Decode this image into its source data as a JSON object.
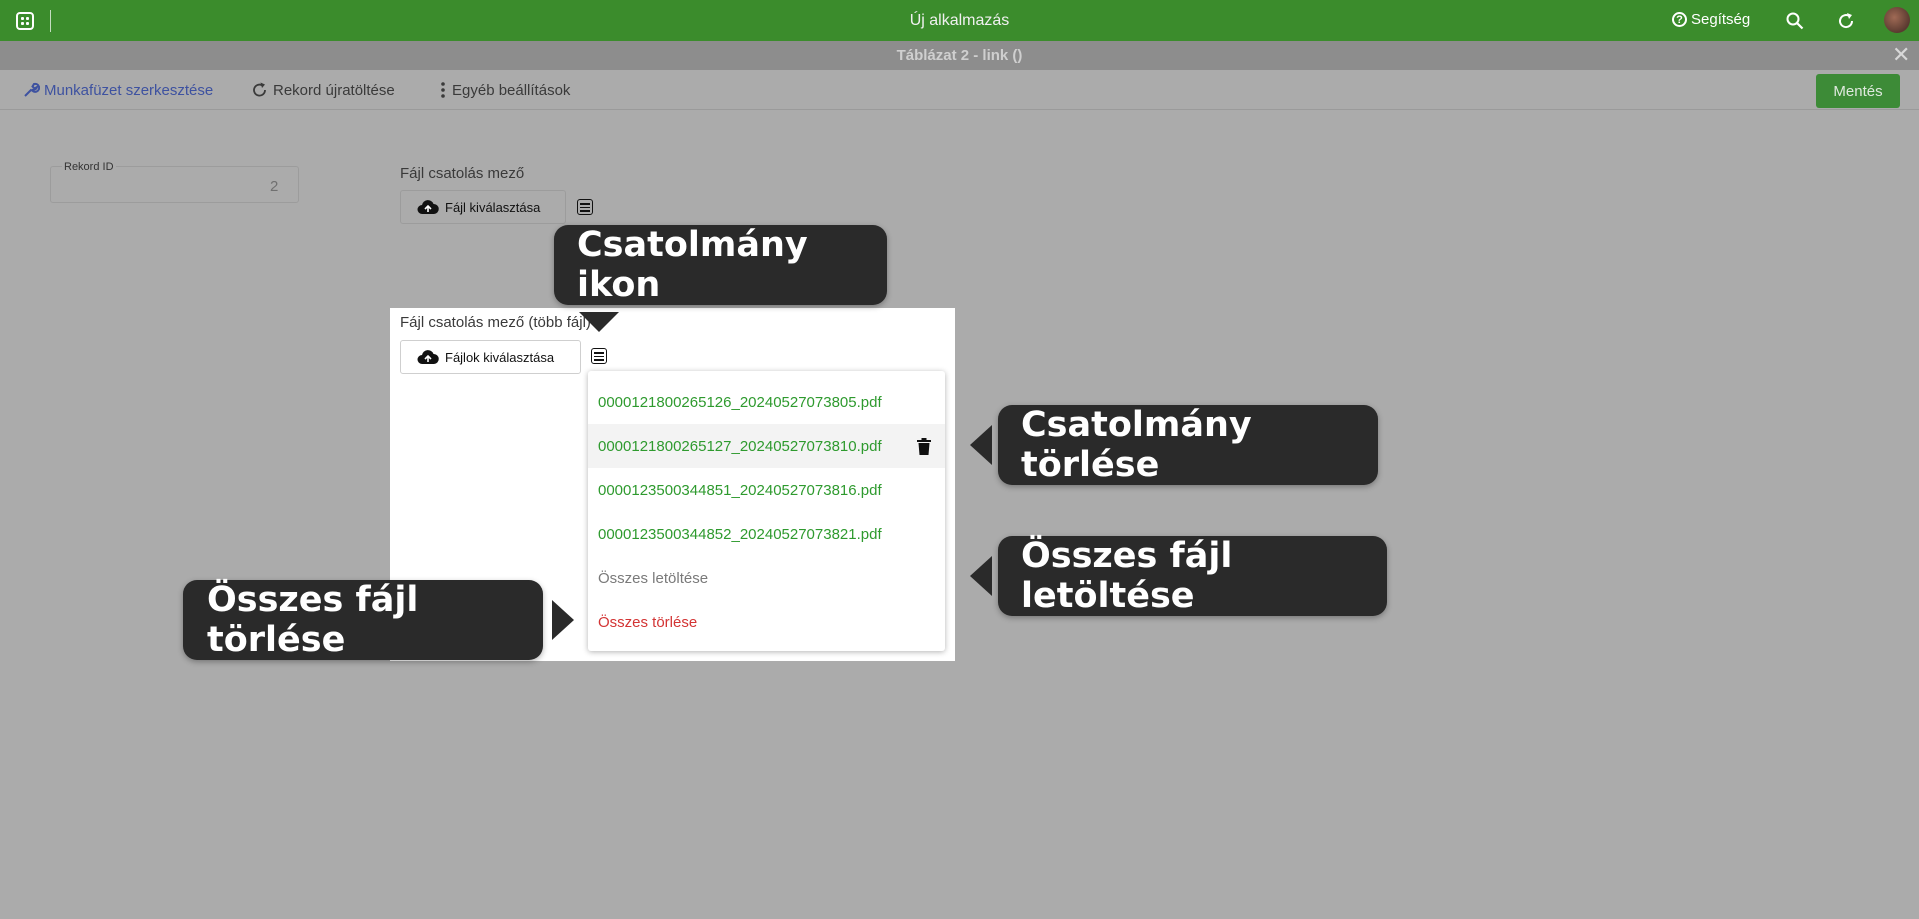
{
  "app": {
    "title": "Új alkalmazás",
    "help_label": "Segítség"
  },
  "window": {
    "subtitle": "Táblázat 2 - link ()",
    "close_glyph": "✕"
  },
  "toolbar": {
    "edit_label": "Munkafüzet szerkesztése",
    "reload_label": "Rekord újratöltése",
    "more_label": "Egyéb beállítások",
    "save_label": "Mentés"
  },
  "record": {
    "label": "Rekord ID",
    "value": "2"
  },
  "field1": {
    "label": "Fájl csatolás mező",
    "button": "Fájl kiválasztása"
  },
  "field2": {
    "label": "Fájl csatolás mező (több fájl)",
    "button": "Fájlok kiválasztása"
  },
  "dropdown": {
    "files": [
      "0000121800265126_20240527073805.pdf",
      "0000121800265127_20240527073810.pdf",
      "0000123500344851_20240527073816.pdf",
      "0000123500344852_20240527073821.pdf"
    ],
    "download_all": "Összes letöltése",
    "delete_all": "Összes törlése"
  },
  "tooltips": {
    "attachment_icon": "Csatolmány ikon",
    "attachment_delete": "Csatolmány törlése",
    "download_all_files": "Összes fájl letöltése",
    "delete_all_files": "Összes fájl törlése"
  },
  "colors": {
    "topbar": "#3b8c2c",
    "overlay": "#ababab",
    "file_link": "#2e9a2e",
    "delete_red": "#d33434",
    "save_button": "#3d8b37",
    "tooltip_bg": "#2a2a2a"
  },
  "icons": [
    "apps-grid-icon",
    "help-icon",
    "search-icon",
    "refresh-icon",
    "wrench-icon",
    "reload-icon",
    "more-vertical-icon",
    "cloud-upload-icon",
    "attachment-list-icon",
    "trash-icon",
    "close-icon"
  ]
}
